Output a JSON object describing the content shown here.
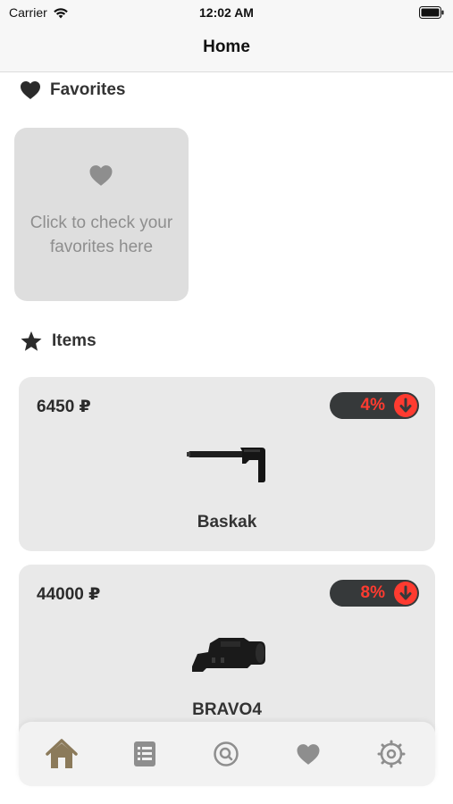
{
  "status_bar": {
    "carrier": "Carrier",
    "time": "12:02 AM"
  },
  "nav": {
    "title": "Home"
  },
  "favorites": {
    "label": "Favorites",
    "card_text": "Click to check your favorites here"
  },
  "items_section": {
    "label": "Items"
  },
  "items": [
    {
      "price": "6450 ₽",
      "discount": "4%",
      "name": "Baskak"
    },
    {
      "price": "44000 ₽",
      "discount": "8%",
      "name": "BRAVO4"
    }
  ],
  "tabs": [
    {
      "icon": "home-icon",
      "active": true
    },
    {
      "icon": "list-icon",
      "active": false
    },
    {
      "icon": "search-icon",
      "active": false
    },
    {
      "icon": "heart-icon",
      "active": false
    },
    {
      "icon": "settings-icon",
      "active": false
    }
  ],
  "colors": {
    "discount": "#ff3b30",
    "active_tab": "#8b7a5a",
    "inactive_tab": "#8e8e8e"
  }
}
